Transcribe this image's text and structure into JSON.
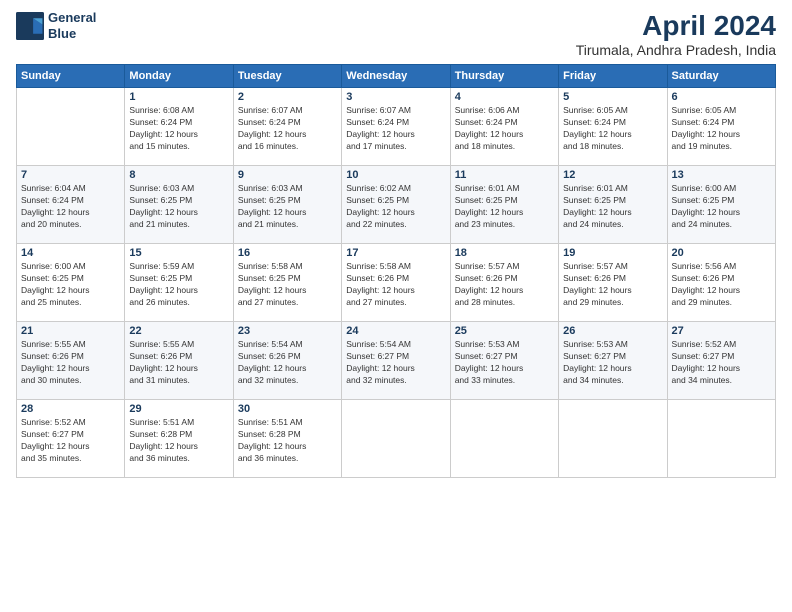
{
  "logo": {
    "line1": "General",
    "line2": "Blue"
  },
  "title": "April 2024",
  "subtitle": "Tirumala, Andhra Pradesh, India",
  "header_days": [
    "Sunday",
    "Monday",
    "Tuesday",
    "Wednesday",
    "Thursday",
    "Friday",
    "Saturday"
  ],
  "weeks": [
    [
      {
        "day": "",
        "info": ""
      },
      {
        "day": "1",
        "info": "Sunrise: 6:08 AM\nSunset: 6:24 PM\nDaylight: 12 hours\nand 15 minutes."
      },
      {
        "day": "2",
        "info": "Sunrise: 6:07 AM\nSunset: 6:24 PM\nDaylight: 12 hours\nand 16 minutes."
      },
      {
        "day": "3",
        "info": "Sunrise: 6:07 AM\nSunset: 6:24 PM\nDaylight: 12 hours\nand 17 minutes."
      },
      {
        "day": "4",
        "info": "Sunrise: 6:06 AM\nSunset: 6:24 PM\nDaylight: 12 hours\nand 18 minutes."
      },
      {
        "day": "5",
        "info": "Sunrise: 6:05 AM\nSunset: 6:24 PM\nDaylight: 12 hours\nand 18 minutes."
      },
      {
        "day": "6",
        "info": "Sunrise: 6:05 AM\nSunset: 6:24 PM\nDaylight: 12 hours\nand 19 minutes."
      }
    ],
    [
      {
        "day": "7",
        "info": "Sunrise: 6:04 AM\nSunset: 6:24 PM\nDaylight: 12 hours\nand 20 minutes."
      },
      {
        "day": "8",
        "info": "Sunrise: 6:03 AM\nSunset: 6:25 PM\nDaylight: 12 hours\nand 21 minutes."
      },
      {
        "day": "9",
        "info": "Sunrise: 6:03 AM\nSunset: 6:25 PM\nDaylight: 12 hours\nand 21 minutes."
      },
      {
        "day": "10",
        "info": "Sunrise: 6:02 AM\nSunset: 6:25 PM\nDaylight: 12 hours\nand 22 minutes."
      },
      {
        "day": "11",
        "info": "Sunrise: 6:01 AM\nSunset: 6:25 PM\nDaylight: 12 hours\nand 23 minutes."
      },
      {
        "day": "12",
        "info": "Sunrise: 6:01 AM\nSunset: 6:25 PM\nDaylight: 12 hours\nand 24 minutes."
      },
      {
        "day": "13",
        "info": "Sunrise: 6:00 AM\nSunset: 6:25 PM\nDaylight: 12 hours\nand 24 minutes."
      }
    ],
    [
      {
        "day": "14",
        "info": "Sunrise: 6:00 AM\nSunset: 6:25 PM\nDaylight: 12 hours\nand 25 minutes."
      },
      {
        "day": "15",
        "info": "Sunrise: 5:59 AM\nSunset: 6:25 PM\nDaylight: 12 hours\nand 26 minutes."
      },
      {
        "day": "16",
        "info": "Sunrise: 5:58 AM\nSunset: 6:25 PM\nDaylight: 12 hours\nand 27 minutes."
      },
      {
        "day": "17",
        "info": "Sunrise: 5:58 AM\nSunset: 6:26 PM\nDaylight: 12 hours\nand 27 minutes."
      },
      {
        "day": "18",
        "info": "Sunrise: 5:57 AM\nSunset: 6:26 PM\nDaylight: 12 hours\nand 28 minutes."
      },
      {
        "day": "19",
        "info": "Sunrise: 5:57 AM\nSunset: 6:26 PM\nDaylight: 12 hours\nand 29 minutes."
      },
      {
        "day": "20",
        "info": "Sunrise: 5:56 AM\nSunset: 6:26 PM\nDaylight: 12 hours\nand 29 minutes."
      }
    ],
    [
      {
        "day": "21",
        "info": "Sunrise: 5:55 AM\nSunset: 6:26 PM\nDaylight: 12 hours\nand 30 minutes."
      },
      {
        "day": "22",
        "info": "Sunrise: 5:55 AM\nSunset: 6:26 PM\nDaylight: 12 hours\nand 31 minutes."
      },
      {
        "day": "23",
        "info": "Sunrise: 5:54 AM\nSunset: 6:26 PM\nDaylight: 12 hours\nand 32 minutes."
      },
      {
        "day": "24",
        "info": "Sunrise: 5:54 AM\nSunset: 6:27 PM\nDaylight: 12 hours\nand 32 minutes."
      },
      {
        "day": "25",
        "info": "Sunrise: 5:53 AM\nSunset: 6:27 PM\nDaylight: 12 hours\nand 33 minutes."
      },
      {
        "day": "26",
        "info": "Sunrise: 5:53 AM\nSunset: 6:27 PM\nDaylight: 12 hours\nand 34 minutes."
      },
      {
        "day": "27",
        "info": "Sunrise: 5:52 AM\nSunset: 6:27 PM\nDaylight: 12 hours\nand 34 minutes."
      }
    ],
    [
      {
        "day": "28",
        "info": "Sunrise: 5:52 AM\nSunset: 6:27 PM\nDaylight: 12 hours\nand 35 minutes."
      },
      {
        "day": "29",
        "info": "Sunrise: 5:51 AM\nSunset: 6:28 PM\nDaylight: 12 hours\nand 36 minutes."
      },
      {
        "day": "30",
        "info": "Sunrise: 5:51 AM\nSunset: 6:28 PM\nDaylight: 12 hours\nand 36 minutes."
      },
      {
        "day": "",
        "info": ""
      },
      {
        "day": "",
        "info": ""
      },
      {
        "day": "",
        "info": ""
      },
      {
        "day": "",
        "info": ""
      }
    ]
  ]
}
